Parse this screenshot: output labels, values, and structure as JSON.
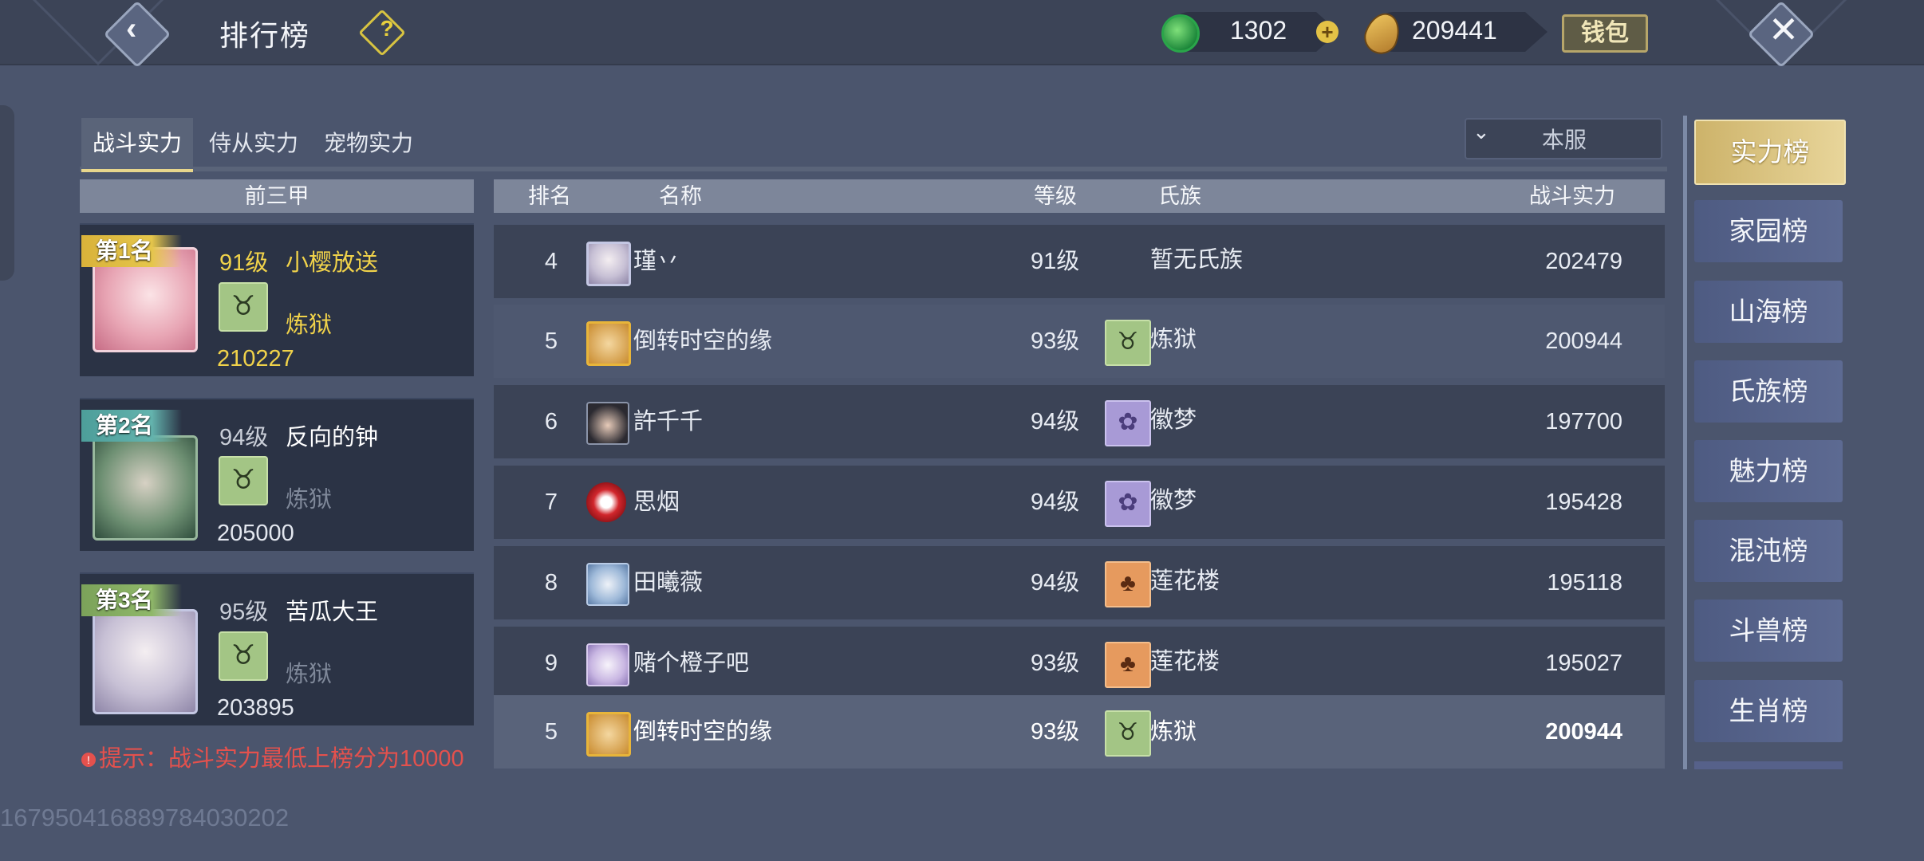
{
  "header": {
    "title": "排行榜",
    "help_icon": "question-icon",
    "jade_amount": "1302",
    "gold_amount": "209441",
    "wallet_label": "钱包"
  },
  "tabs": [
    {
      "label": "战斗实力",
      "active": true
    },
    {
      "label": "侍从实力",
      "active": false
    },
    {
      "label": "宠物实力",
      "active": false
    }
  ],
  "server_filter": {
    "selected": "本服"
  },
  "top_three": {
    "header": "前三甲",
    "entries": [
      {
        "rank_label": "第1名",
        "level": "91级",
        "name": "小樱放送",
        "clan": "炼狱",
        "power": "210227"
      },
      {
        "rank_label": "第2名",
        "level": "94级",
        "name": "反向的钟",
        "clan": "炼狱",
        "power": "205000"
      },
      {
        "rank_label": "第3名",
        "level": "95级",
        "name": "苦瓜大王",
        "clan": "炼狱",
        "power": "203895"
      }
    ]
  },
  "hint": {
    "icon": "alert-icon",
    "text": "提示：战斗实力最低上榜分为10000"
  },
  "table": {
    "headers": {
      "rank": "排名",
      "name": "名称",
      "level": "等级",
      "clan": "氏族",
      "power": "战斗实力"
    },
    "rows": [
      {
        "rank": "4",
        "name": "瑾丷",
        "level": "91级",
        "clan": "暂无氏族",
        "power": "202479"
      },
      {
        "rank": "5",
        "name": "倒转时空的缘",
        "level": "93级",
        "clan": "炼狱",
        "power": "200944"
      },
      {
        "rank": "6",
        "name": "許千千",
        "level": "94级",
        "clan": "徽梦",
        "power": "197700"
      },
      {
        "rank": "7",
        "name": "思烟",
        "level": "94级",
        "clan": "徽梦",
        "power": "195428"
      },
      {
        "rank": "8",
        "name": "田曦薇",
        "level": "94级",
        "clan": "莲花楼",
        "power": "195118"
      },
      {
        "rank": "9",
        "name": "赌个橙子吧",
        "level": "93级",
        "clan": "莲花楼",
        "power": "195027"
      }
    ],
    "self_row": {
      "rank": "5",
      "name": "倒转时空的缘",
      "level": "93级",
      "clan": "炼狱",
      "power": "200944"
    }
  },
  "sidebar": [
    {
      "label": "实力榜",
      "active": true
    },
    {
      "label": "家园榜"
    },
    {
      "label": "山海榜"
    },
    {
      "label": "氏族榜"
    },
    {
      "label": "魅力榜"
    },
    {
      "label": "混沌榜"
    },
    {
      "label": "斗兽榜"
    },
    {
      "label": "生肖榜"
    }
  ],
  "uid": "16795041688978403020​2"
}
